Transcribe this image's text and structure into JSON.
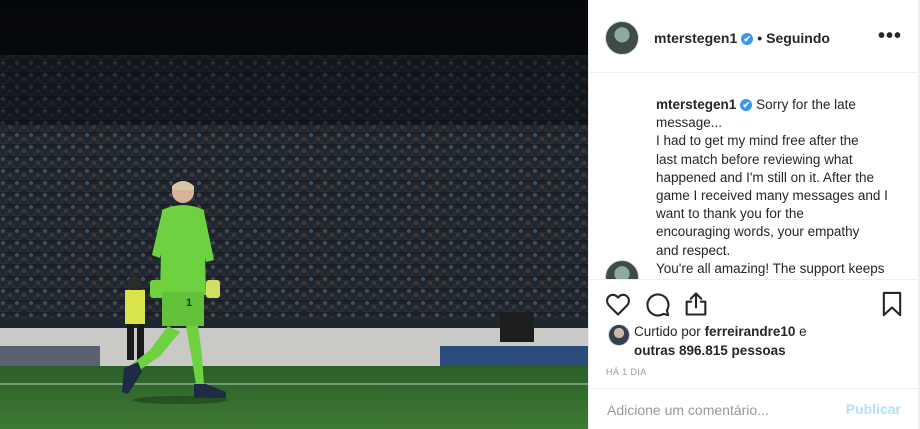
{
  "post": {
    "username": "mterstegen1",
    "verified_badge": "✔",
    "separator": "•",
    "follow_label": "Seguindo",
    "more_icon": "more-horizontal-icon",
    "more_label": "•••"
  },
  "caption": {
    "username": "mterstegen1",
    "verified_badge": "✔",
    "lines": [
      "Sorry for the late",
      "message...",
      "I had to get my mind free after the",
      "last match before reviewing what",
      "happened and I'm still on it. After the",
      "game I received many messages and I",
      "want to thank you for the",
      "encouraging words, your empathy",
      "and respect.",
      "You're all amazing! The support keeps"
    ]
  },
  "actions": {
    "like_icon": "heart-icon",
    "comment_icon": "comment-icon",
    "share_icon": "share-icon",
    "save_icon": "bookmark-icon"
  },
  "likes": {
    "prefix": "Curtido por",
    "user": "ferreirandre10",
    "middle": "e",
    "others": "outras 896.815 pessoas"
  },
  "timestamp": "HÁ 1 DIA",
  "comment_box": {
    "placeholder": "Adicione um comentário...",
    "publish_label": "Publicar"
  },
  "photo": {
    "jersey_number": "1"
  },
  "colors": {
    "accent_blue": "#3897f0",
    "publish_disabled": "#b2dffc",
    "kit_green": "#6ed13f",
    "pitch_green": "#2f6b2a"
  }
}
